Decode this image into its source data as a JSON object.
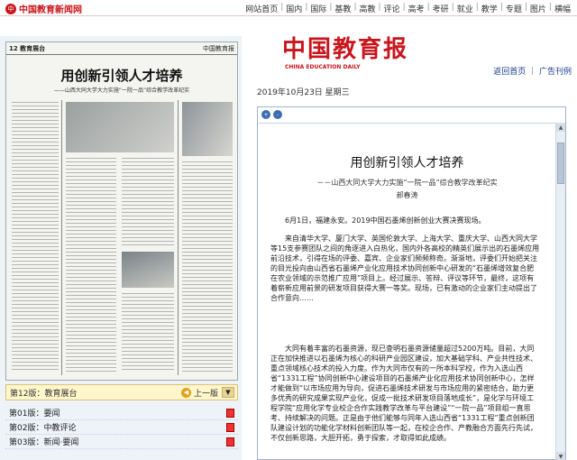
{
  "site": {
    "logo_mark": "中",
    "logo_text": "中国教育新闻网"
  },
  "nav": {
    "items": [
      "网站首页",
      "国内",
      "国际",
      "基教",
      "高教",
      "评论",
      "高考",
      "考研",
      "就业",
      "教学",
      "专题",
      "图片",
      "横幅"
    ]
  },
  "scan": {
    "page_label": "12 教育展台",
    "paper_name": "中国教育报",
    "title": "用创新引领人才培养",
    "subtitle": "——山西大同大学大力实施“一院一品”综合教学改革纪实"
  },
  "pagebar": {
    "label": "第12版：教育展台",
    "up_label": "上一版",
    "up_icon": "◀",
    "arrow_icon": "▼"
  },
  "pagelist": {
    "items": [
      "第01版：要闻",
      "第02版：中教评论",
      "第03版：新闻·要闻"
    ]
  },
  "masthead": {
    "logo": "中国教育报",
    "english": "CHINA EDUCATION DAILY",
    "links": "返回首页 ｜ 广告刊例"
  },
  "date": "2019年10月23日 星期三",
  "article": {
    "tool_icons": [
      "+",
      "-"
    ],
    "title": "用创新引领人才培养",
    "subtitle": "－－山西大同大学大力实施“一院一品”综合教学改革纪实",
    "author": "郝春涛",
    "paragraphs": [
      "6月1日，福建永安。2019中国石墨烯创新创业大赛决赛现场。",
      "来自清华大学、厦门大学、英国伦敦大学、上海大学、重庆大学、山西大同大学等15支参赛团队之间的角逐进入白热化，国内外各高校的精英们展示出的石墨烯应用前沿技术，引得在场的评委、嘉宾、企业家们频频称奇。渐渐地，评委们开始把关注的目光投向由山西省石墨烯产业化应用技术协同创新中心研发的“石墨烯增效复合肥在农业领域的示范推广应用”项目上。经过展示、答辩、评议等环节，最终，这项有着崭新应用前景的研发项目获得大赛一等奖。现场，已有激动的企业家们主动提出了合作意向……",
      "大同有着丰富的石墨资源，现已查明石墨资源储量超过5200万吨。目前，大同正在加快推进以石墨烯为核心的科研产业园区建设，加大基础学科、产业共性技术、重点领域核心技术的投入力度。作为大同市仅有的一所本科学校，作为入选山西省“1331工程”协同创新中心建设项目的石墨烯产业化应用技术协同创新中心，怎样才能做到“以市场应用为导向，促进石墨烯技术研发与市场应用的紧密结合，助力更多优秀的研究成果实现产业化，促成一批技术研发项目落地成长”，是化学与环境工程学院“应用化学专业校企合作实践教学改革与平台建设”“一院一品”项目组一直思考、持续解决的问题。正是由于他们能够与同年入选山西省“1331工程”重点创新团队建设计划的功能化学材料创新团队等一起，在校企合作、产教融合方面先行先试，不仅创新思路，大胆开拓，勇于探索，才取得如此成绩。"
    ]
  },
  "scrollbar": {
    "up_icon": "▲",
    "down_icon": "▼"
  }
}
